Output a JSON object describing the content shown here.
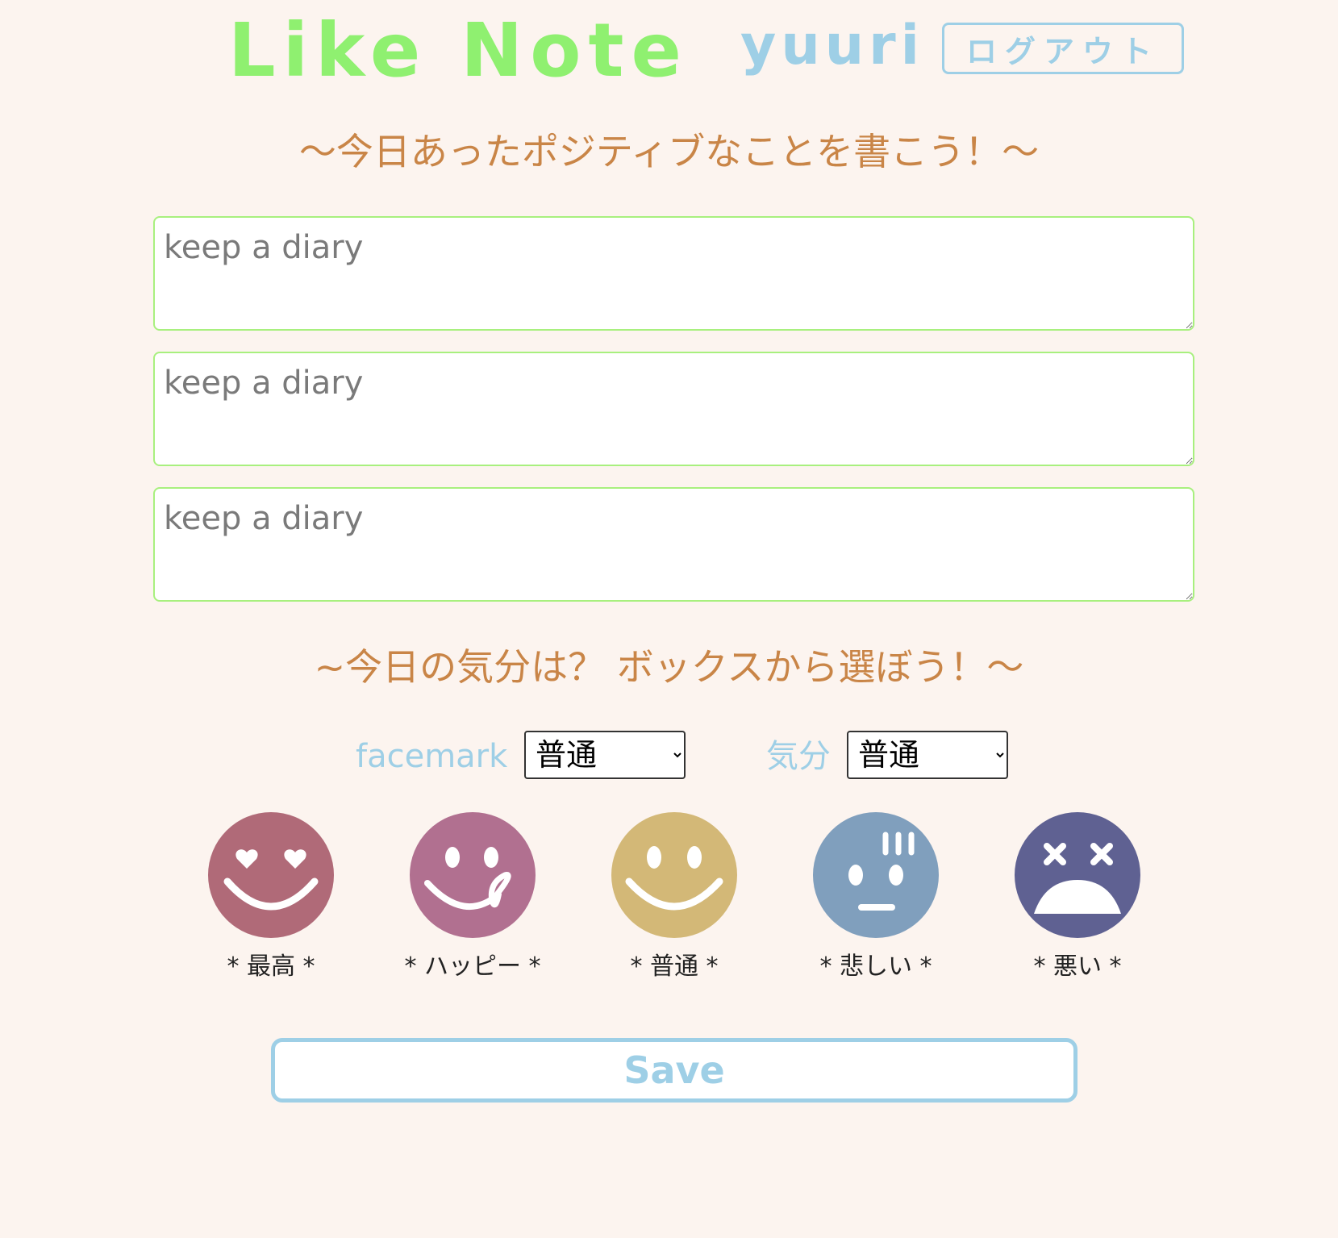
{
  "header": {
    "app_title": "Like Note",
    "user_name": "yuuri",
    "logout_label": "ログアウト"
  },
  "diary": {
    "heading": "〜今日あったポジティブなことを書こう！〜",
    "fields": [
      {
        "placeholder": "keep a diary",
        "value": ""
      },
      {
        "placeholder": "keep a diary",
        "value": ""
      },
      {
        "placeholder": "keep a diary",
        "value": ""
      }
    ]
  },
  "mood": {
    "heading": "~今日の気分は？ ボックスから選ぼう！〜",
    "facemark_label": "facemark",
    "facemark_selected": "普通",
    "mood_label": "気分",
    "mood_selected": "普通"
  },
  "faces": [
    {
      "caption": "* 最高 *",
      "icon": "heart-eyes-face-icon",
      "color": "#b06a78"
    },
    {
      "caption": "* ハッピー *",
      "icon": "tongue-face-icon",
      "color": "#b17090"
    },
    {
      "caption": "* 普通 *",
      "icon": "smile-face-icon",
      "color": "#d3b877"
    },
    {
      "caption": "* 悲しい *",
      "icon": "shocked-face-icon",
      "color": "#809fbd"
    },
    {
      "caption": "* 悪い *",
      "icon": "dizzy-sad-face-icon",
      "color": "#5f6192"
    }
  ],
  "actions": {
    "save_label": "Save"
  },
  "colors": {
    "background": "#fcf4ef",
    "title_green": "#8ff070",
    "accent_blue": "#9ecfe6",
    "heading_orange": "#c98547",
    "field_border": "#a8f07e"
  }
}
